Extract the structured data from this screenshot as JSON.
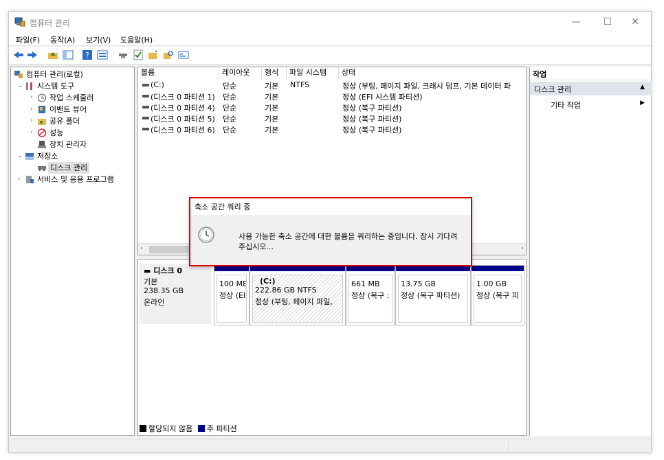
{
  "window": {
    "title": "컴퓨터 관리"
  },
  "window_controls": {
    "minimize": "—",
    "maximize": "☐",
    "close": "✕"
  },
  "menu": [
    "파일(F)",
    "동작(A)",
    "보기(V)",
    "도움말(H)"
  ],
  "tree": {
    "root": "컴퓨터 관리(로컬)",
    "system_tools": "시스템 도구",
    "task_scheduler": "작업 스케줄러",
    "event_viewer": "이벤트 뷰어",
    "shared_folders": "공유 폴더",
    "performance": "성능",
    "device_manager": "장치 관리자",
    "storage": "저장소",
    "disk_management": "디스크 관리",
    "services": "서비스 및 응용 프로그램"
  },
  "volumes": {
    "headers": [
      "볼륨",
      "레이아웃",
      "형식",
      "파일 시스템",
      "상태"
    ],
    "rows": [
      [
        "(C:)",
        "단순",
        "기본",
        "NTFS",
        "정상 (부팅, 페이지 파일, 크래시 덤프, 기본 데이터 파"
      ],
      [
        "(디스크 0 파티션 1)",
        "단순",
        "기본",
        "",
        "정상 (EFI 시스템 파티션)"
      ],
      [
        "(디스크 0 파티션 4)",
        "단순",
        "기본",
        "",
        "정상 (복구 파티션)"
      ],
      [
        "(디스크 0 파티션 5)",
        "단순",
        "기본",
        "",
        "정상 (복구 파티션)"
      ],
      [
        "(디스크 0 파티션 6)",
        "단순",
        "기본",
        "",
        "정상 (복구 파티션)"
      ]
    ]
  },
  "disk": {
    "name": "디스크 0",
    "type": "기본",
    "size": "238.35 GB",
    "status": "온라인",
    "partitions": [
      {
        "line1": "",
        "line2": "100 ME",
        "line3": "정상 (EI"
      },
      {
        "line1": "(C:)",
        "line2": "222.86 GB NTFS",
        "line3": "정상 (부팅, 페이지 파일,"
      },
      {
        "line1": "",
        "line2": "661 MB",
        "line3": "정상 (복구 :"
      },
      {
        "line1": "",
        "line2": "13.75 GB",
        "line3": "정상 (복구 파티션)"
      },
      {
        "line1": "",
        "line2": "1.00 GB",
        "line3": "정상 (복구 피"
      }
    ]
  },
  "legend": {
    "unallocated": "할당되지 않음",
    "primary": "주 파티션"
  },
  "actions": {
    "header": "작업",
    "section": "디스크 관리",
    "item": "기타 작업"
  },
  "dialog": {
    "title": "축소 공간 쿼리 중",
    "message": "사용 가능한 축소 공간에 대한 볼륨을 쿼리하는 중입니다. 잠시 기다려 주십시오..."
  },
  "colors": {
    "primary_partition": "#00008b",
    "dialog_border": "#d80000",
    "selection": "#dfe4ec"
  }
}
